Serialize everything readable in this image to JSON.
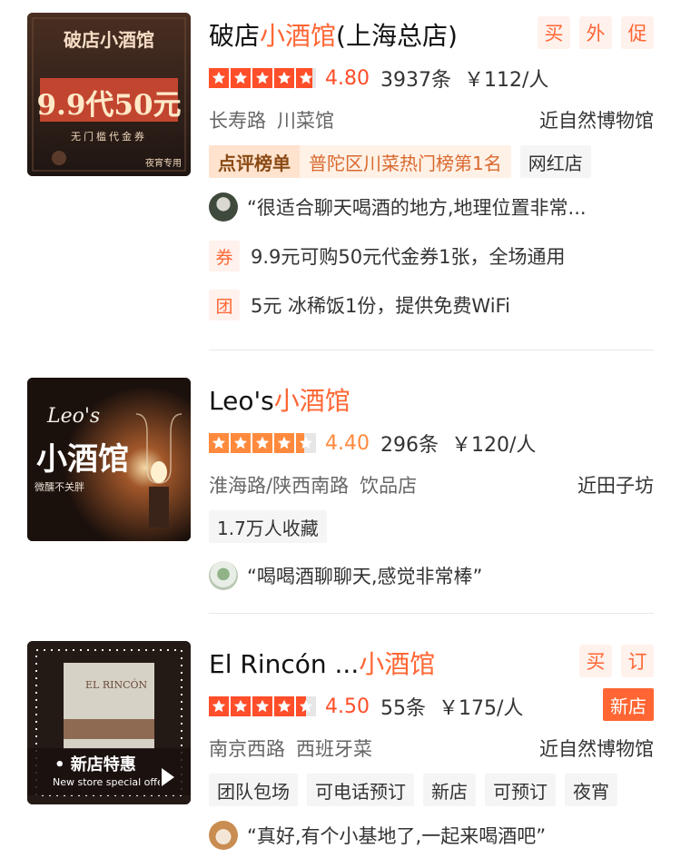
{
  "colors": {
    "accent": "#ff6633",
    "star_on": "#ff4e2a",
    "star_partial": "#ff8a3d"
  },
  "shops": [
    {
      "title_prefix": "破店",
      "title_highlight": "小酒馆",
      "title_suffix": "(上海总店)",
      "actions": [
        "买",
        "外",
        "促"
      ],
      "rating": 4.8,
      "score": "4.80",
      "reviews": "3937条",
      "price": "￥112/人",
      "area": "长寿路",
      "category": "川菜馆",
      "nearby": "近自然博物馆",
      "rank": {
        "name": "点评榜单",
        "text": "普陀区川菜热门榜第1名"
      },
      "tags": [
        "网红店"
      ],
      "review": "“很适合聊天喝酒的地方,地理位置非常...",
      "deals": [
        {
          "icon": "券",
          "text": "9.9元可购50元代金券1张，全场通用"
        },
        {
          "icon": "团",
          "text": "5元 冰稀饭1份，提供免费WiFi"
        }
      ],
      "thumb": {
        "title": "破店小酒馆",
        "big": "9.9代50元",
        "sub": "无门槛代金券",
        "note": "夜宵专用"
      }
    },
    {
      "title_prefix": "Leo's",
      "title_highlight": "小酒馆",
      "title_suffix": "",
      "actions": [],
      "rating": 4.4,
      "score": "4.40",
      "reviews": "296条",
      "price": "￥120/人",
      "area": "淮海路/陕西南路",
      "category": "饮品店",
      "nearby": "近田子坊",
      "tags": [
        "1.7万人收藏"
      ],
      "review": "“喝喝酒聊聊天,感觉非常棒”",
      "thumb": {
        "latin": "Leo's",
        "big": "小酒馆",
        "sub": "微醺不关胖"
      }
    },
    {
      "title_prefix": "El Rincón ...",
      "title_highlight": "小酒馆",
      "title_suffix": "",
      "actions": [
        "买",
        "订"
      ],
      "new_badge": "新店",
      "rating": 4.5,
      "score": "4.50",
      "reviews": "55条",
      "price": "￥175/人",
      "area": "南京西路",
      "category": "西班牙菜",
      "nearby": "近自然博物馆",
      "tags": [
        "团队包场",
        "可电话预订",
        "新店",
        "可预订",
        "夜宵"
      ],
      "review": "“真好,有个小基地了,一起来喝酒吧”",
      "thumb": {
        "sign": "EL RINCÓN",
        "big": "• 新店特惠",
        "sub": "New store special offer"
      }
    }
  ]
}
